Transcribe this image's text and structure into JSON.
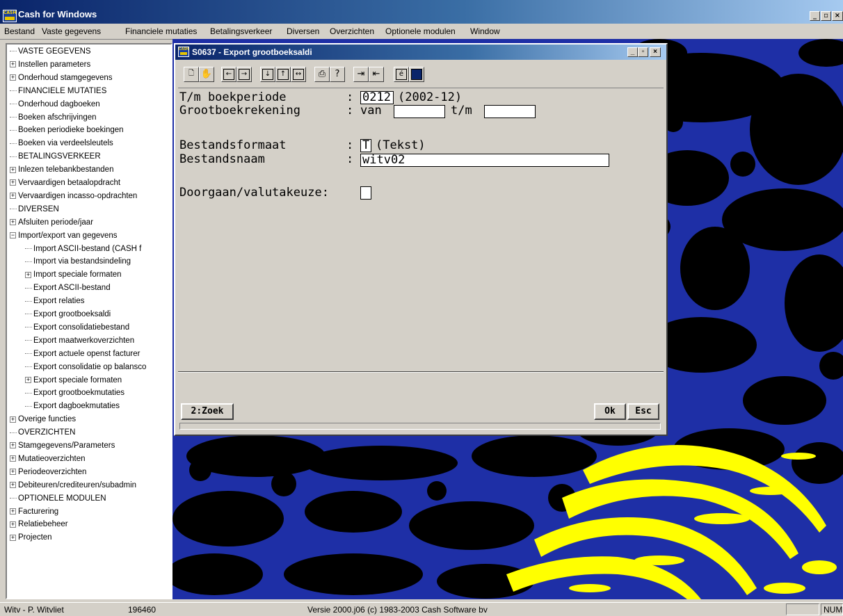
{
  "app": {
    "title": "Cash for Windows",
    "icon_text": "CASH",
    "window_controls": [
      "_",
      "▫",
      "×"
    ]
  },
  "menu": [
    "Bestand",
    "Vaste gegevens",
    "Financiele mutaties",
    "Betalingsverkeer",
    "Diversen",
    "Overzichten",
    "Optionele modulen",
    "Window"
  ],
  "tree": [
    {
      "label": "VASTE GEGEVENS",
      "level": 0,
      "type": "leaf"
    },
    {
      "label": "Instellen parameters",
      "level": 0,
      "type": "plus"
    },
    {
      "label": "Onderhoud stamgegevens",
      "level": 0,
      "type": "plus"
    },
    {
      "label": "FINANCIELE MUTATIES",
      "level": 0,
      "type": "leaf"
    },
    {
      "label": "Onderhoud dagboeken",
      "level": 0,
      "type": "leaf"
    },
    {
      "label": "Boeken afschrijvingen",
      "level": 0,
      "type": "leaf"
    },
    {
      "label": "Boeken periodieke boekingen",
      "level": 0,
      "type": "leaf"
    },
    {
      "label": "Boeken via verdeelsleutels",
      "level": 0,
      "type": "leaf"
    },
    {
      "label": "BETALINGSVERKEER",
      "level": 0,
      "type": "leaf"
    },
    {
      "label": "Inlezen telebankbestanden",
      "level": 0,
      "type": "plus"
    },
    {
      "label": "Vervaardigen betaalopdracht",
      "level": 0,
      "type": "plus"
    },
    {
      "label": "Vervaardigen incasso-opdrachten",
      "level": 0,
      "type": "plus"
    },
    {
      "label": "DIVERSEN",
      "level": 0,
      "type": "leaf"
    },
    {
      "label": "Afsluiten periode/jaar",
      "level": 0,
      "type": "plus"
    },
    {
      "label": "Import/export van gegevens",
      "level": 0,
      "type": "minus"
    },
    {
      "label": "Import ASCII-bestand (CASH f",
      "level": 1,
      "type": "leaf"
    },
    {
      "label": "Import via bestandsindeling",
      "level": 1,
      "type": "leaf"
    },
    {
      "label": "Import speciale formaten",
      "level": 1,
      "type": "plus"
    },
    {
      "label": "Export ASCII-bestand",
      "level": 1,
      "type": "leaf"
    },
    {
      "label": "Export relaties",
      "level": 1,
      "type": "leaf"
    },
    {
      "label": "Export grootboeksaldi",
      "level": 1,
      "type": "leaf"
    },
    {
      "label": "Export consolidatiebestand",
      "level": 1,
      "type": "leaf"
    },
    {
      "label": "Export maatwerkoverzichten",
      "level": 1,
      "type": "leaf"
    },
    {
      "label": "Export actuele openst facturer",
      "level": 1,
      "type": "leaf"
    },
    {
      "label": "Export consolidatie op balansco",
      "level": 1,
      "type": "leaf"
    },
    {
      "label": "Export speciale formaten",
      "level": 1,
      "type": "plus"
    },
    {
      "label": "Export grootboekmutaties",
      "level": 1,
      "type": "leaf"
    },
    {
      "label": "Export dagboekmutaties",
      "level": 1,
      "type": "leaf"
    },
    {
      "label": "Overige functies",
      "level": 0,
      "type": "plus"
    },
    {
      "label": "OVERZICHTEN",
      "level": 0,
      "type": "leaf"
    },
    {
      "label": "Stamgegevens/Parameters",
      "level": 0,
      "type": "plus"
    },
    {
      "label": "Mutatieoverzichten",
      "level": 0,
      "type": "plus"
    },
    {
      "label": "Periodeoverzichten",
      "level": 0,
      "type": "plus"
    },
    {
      "label": "Debiteuren/crediteuren/subadmin",
      "level": 0,
      "type": "plus"
    },
    {
      "label": "OPTIONELE MODULEN",
      "level": 0,
      "type": "leaf"
    },
    {
      "label": "Facturering",
      "level": 0,
      "type": "plus"
    },
    {
      "label": "Relatiebeheer",
      "level": 0,
      "type": "plus"
    },
    {
      "label": "Projecten",
      "level": 0,
      "type": "plus"
    }
  ],
  "dialog": {
    "title": "S0637 - Export grootboeksaldi",
    "toolbar_icons": [
      "new-icon",
      "hand-icon",
      "first-icon",
      "last-icon",
      "down-icon",
      "up-icon",
      "width-icon",
      "print-icon",
      "help-icon",
      "copy-icon",
      "paste-icon",
      "euro-icon",
      "calculator-icon"
    ],
    "form": {
      "period_label": "T/m boekperiode",
      "colon": ":",
      "period_value": "0212",
      "period_desc": "(2002-12)",
      "account_label": "Grootboekrekening",
      "from_label": "van",
      "from_value": "",
      "to_label": "t/m",
      "to_value": "",
      "format_label": "Bestandsformaat",
      "format_value": "T",
      "format_desc": "(Tekst)",
      "filename_label": "Bestandsnaam",
      "filename_value": "witv02",
      "continue_label": "Doorgaan/valutakeuze:",
      "continue_value": ""
    },
    "buttons": {
      "search": "2:Zoek",
      "ok": "Ok",
      "esc": "Esc"
    }
  },
  "statusbar": {
    "user": "Witv - P. Witvliet",
    "number": "196460",
    "version": "Versie 2000.j06  (c) 1983-2003 Cash Software bv",
    "num": "NUM"
  },
  "colors": {
    "titlebar_start": "#0a246a",
    "desktop_blue": "#1e2fa6",
    "desktop_yellow": "#ffff00",
    "face": "#d4d0c8"
  }
}
